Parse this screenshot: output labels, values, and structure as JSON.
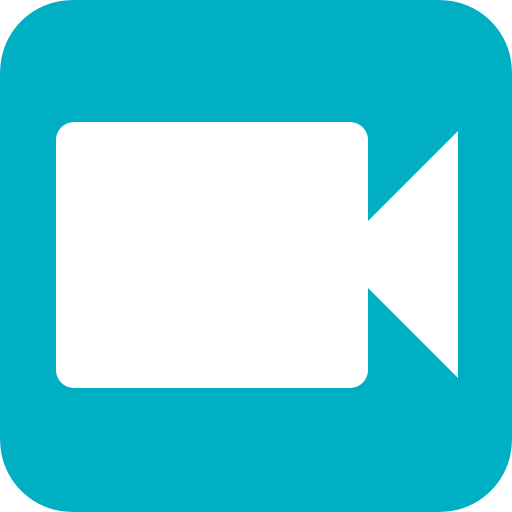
{
  "icon": {
    "name": "video-camera-icon",
    "colors": {
      "background": "#00AFC3",
      "glyph": "#FFFFFF"
    }
  }
}
